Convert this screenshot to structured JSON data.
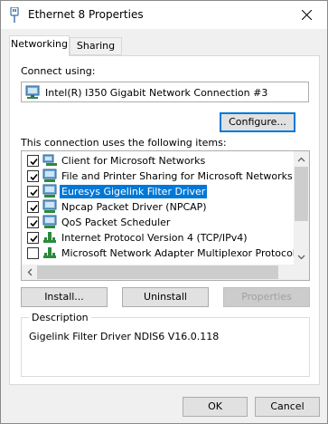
{
  "window": {
    "title": "Ethernet 8 Properties"
  },
  "tabs": [
    {
      "label": "Networking",
      "active": true
    },
    {
      "label": "Sharing",
      "active": false
    }
  ],
  "connect_using": {
    "label": "Connect using:",
    "adapter": "Intel(R) I350 Gigabit Network Connection #3",
    "configure_button": "Configure..."
  },
  "items_section": {
    "label": "This connection uses the following items:",
    "items": [
      {
        "label": "Client for Microsoft Networks",
        "checked": true,
        "icon": "network-client-icon",
        "selected": false
      },
      {
        "label": "File and Printer Sharing for Microsoft Networks",
        "checked": true,
        "icon": "network-service-icon",
        "selected": false
      },
      {
        "label": "Euresys Gigelink Filter Driver",
        "checked": true,
        "icon": "network-service-icon",
        "selected": true
      },
      {
        "label": "Npcap Packet Driver (NPCAP)",
        "checked": true,
        "icon": "network-service-icon",
        "selected": false
      },
      {
        "label": "QoS Packet Scheduler",
        "checked": true,
        "icon": "network-service-icon",
        "selected": false
      },
      {
        "label": "Internet Protocol Version 4 (TCP/IPv4)",
        "checked": true,
        "icon": "protocol-icon",
        "selected": false
      },
      {
        "label": "Microsoft Network Adapter Multiplexor Protocol",
        "checked": false,
        "icon": "protocol-icon",
        "selected": false
      }
    ]
  },
  "buttons": {
    "install": "Install...",
    "uninstall": "Uninstall",
    "properties": "Properties",
    "ok": "OK",
    "cancel": "Cancel"
  },
  "description": {
    "title": "Description",
    "text": "Gigelink Filter Driver NDIS6 V16.0.118"
  },
  "colors": {
    "selection": "#0078d7",
    "focus_border": "#0078d7"
  }
}
